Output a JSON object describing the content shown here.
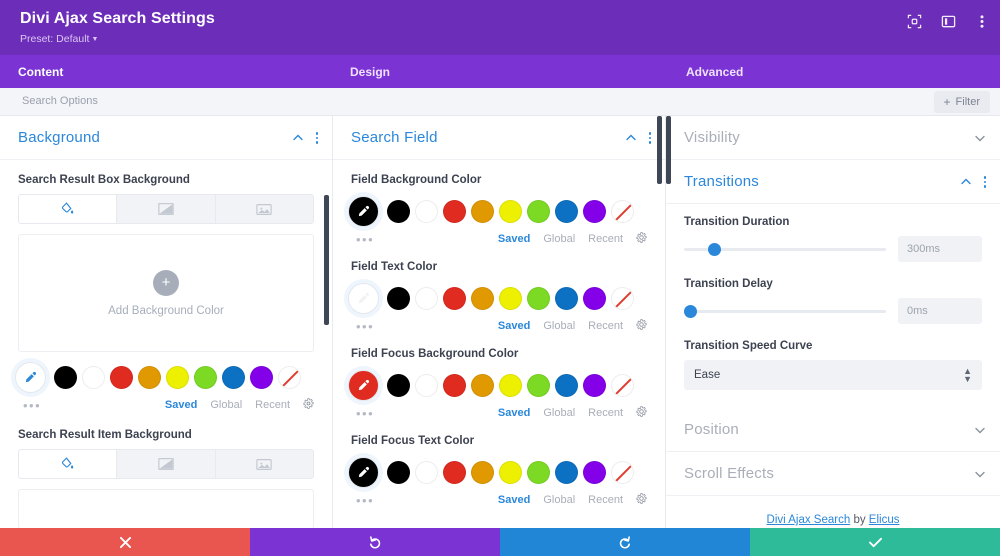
{
  "header": {
    "title": "Divi Ajax Search Settings",
    "preset_label": "Preset: Default",
    "icons": [
      {
        "name": "responsive-view-icon"
      },
      {
        "name": "panel-layout-icon"
      },
      {
        "name": "more-options-icon"
      }
    ]
  },
  "tabs": [
    {
      "label": "Content",
      "active": true
    },
    {
      "label": "Design",
      "active": false
    },
    {
      "label": "Advanced",
      "active": false
    }
  ],
  "options_bar": {
    "search_placeholder": "Search Options",
    "filter_label": "Filter",
    "filter_plus": "+"
  },
  "swatch_palette": [
    {
      "name": "black",
      "hex": "#000000"
    },
    {
      "name": "white",
      "hex": "#FFFFFF"
    },
    {
      "name": "red",
      "hex": "#E02B20"
    },
    {
      "name": "orange",
      "hex": "#E09900"
    },
    {
      "name": "yellow",
      "hex": "#EDF000"
    },
    {
      "name": "green",
      "hex": "#7CDA24"
    },
    {
      "name": "blue",
      "hex": "#0C71C3"
    },
    {
      "name": "purple",
      "hex": "#8300E9"
    },
    {
      "name": "transparent",
      "hex": "transparent"
    }
  ],
  "swatch_links": {
    "saved": "Saved",
    "global": "Global",
    "recent": "Recent",
    "more": "•••",
    "settings_icon": "gear-icon"
  },
  "background_types": [
    {
      "name": "color-tab",
      "icon": "paint-bucket-icon",
      "active": true
    },
    {
      "name": "gradient-tab",
      "icon": "gradient-icon",
      "active": false
    },
    {
      "name": "image-tab",
      "icon": "image-icon",
      "active": false
    }
  ],
  "left_column": {
    "toggle": {
      "title": "Background",
      "state": "open"
    },
    "field1": {
      "label": "Search Result Box Background",
      "add_label": "Add Background Color",
      "add_plus": "+",
      "selected_color": "#FFFFFF"
    },
    "field2": {
      "label": "Search Result Item Background"
    }
  },
  "middle_column": {
    "toggle": {
      "title": "Search Field",
      "state": "open"
    },
    "fields": [
      {
        "label": "Field Background Color",
        "selected_color": "#000000"
      },
      {
        "label": "Field Text Color",
        "selected_color": "#FFFFFF"
      },
      {
        "label": "Field Focus Background Color",
        "selected_color": "#E02B20"
      },
      {
        "label": "Field Focus Text Color",
        "selected_color": "#000000"
      }
    ]
  },
  "right_column": {
    "sections": [
      {
        "title": "Visibility",
        "state": "closed"
      },
      {
        "title": "Transitions",
        "state": "open"
      },
      {
        "title": "Position",
        "state": "closed"
      },
      {
        "title": "Scroll Effects",
        "state": "closed"
      }
    ],
    "transition_duration": {
      "label": "Transition Duration",
      "value": "300ms",
      "percent": 12
    },
    "transition_delay": {
      "label": "Transition Delay",
      "value": "0ms",
      "percent": 0
    },
    "speed_curve": {
      "label": "Transition Speed Curve",
      "value": "Ease"
    },
    "credit": {
      "prefix": "Divi Ajax Search",
      "middle": " by ",
      "suffix": "Elicus"
    }
  },
  "bottom_bar": [
    {
      "name": "close-button",
      "icon": "close-icon",
      "color": "#e8564f"
    },
    {
      "name": "undo-button",
      "icon": "undo-icon",
      "color": "#7b33d4"
    },
    {
      "name": "redo-button",
      "icon": "redo-icon",
      "color": "#2186d5"
    },
    {
      "name": "save-button",
      "icon": "check-icon",
      "color": "#2dbb9a"
    }
  ]
}
